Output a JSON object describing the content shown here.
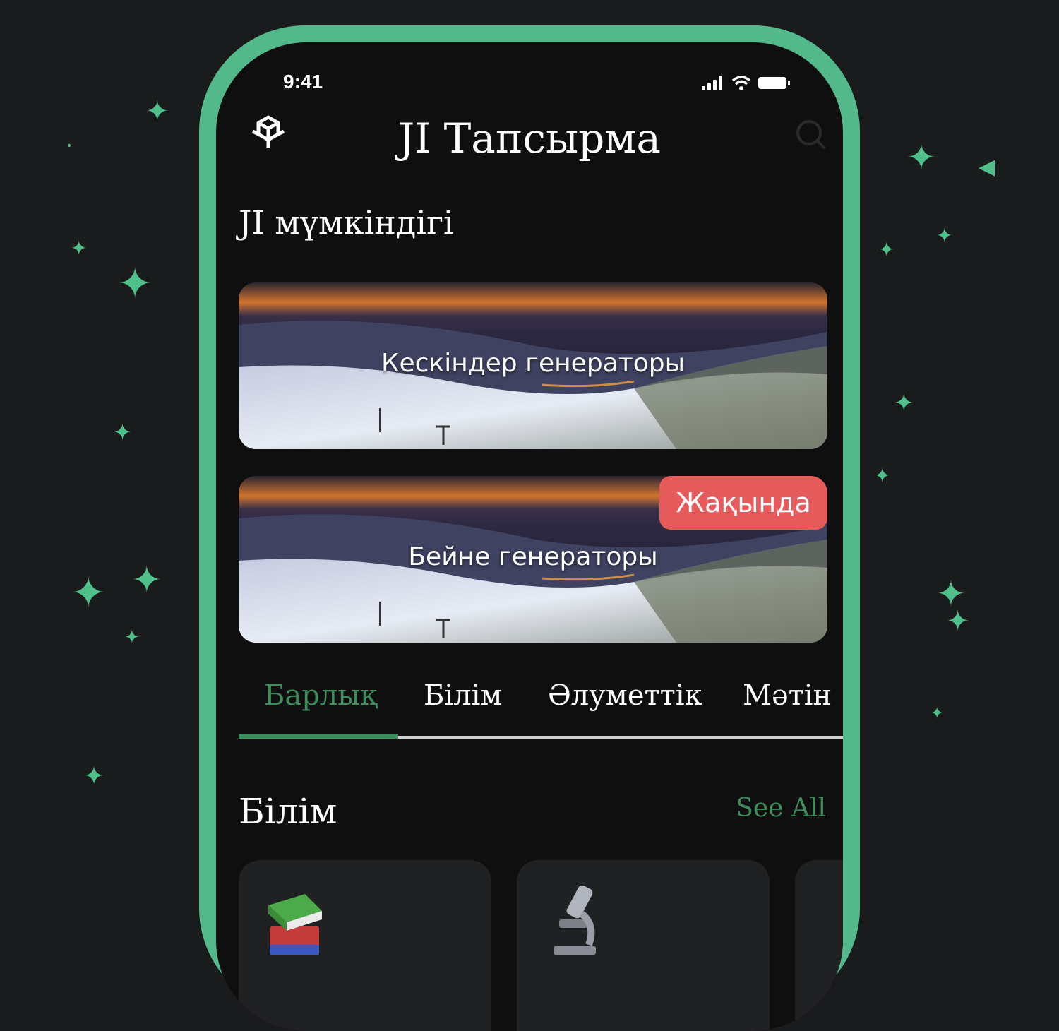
{
  "status_bar": {
    "time": "9:41"
  },
  "header": {
    "title": "JI Тапсырма"
  },
  "section": {
    "title": "JI мүмкіндігі"
  },
  "banners": [
    {
      "label": "Кескіндер генераторы"
    },
    {
      "label": "Бейне генераторы",
      "badge": "Жақында"
    }
  ],
  "tabs": [
    {
      "label": "Барлық",
      "active": true
    },
    {
      "label": "Білім"
    },
    {
      "label": "Әлуметтік"
    },
    {
      "label": "Мәтін"
    }
  ],
  "category": {
    "title": "Білім",
    "see_all": "See All"
  },
  "cards": [
    {
      "icon": "books-icon"
    },
    {
      "icon": "microscope-icon"
    },
    {
      "icon": "unknown-icon"
    }
  ],
  "colors": {
    "accent": "#3d8d5c",
    "frame": "#54b98a",
    "badge": "#e55a5a",
    "sparkle": "#4fc08a",
    "background": "#1a1b1d",
    "screen": "#0f0f10"
  }
}
